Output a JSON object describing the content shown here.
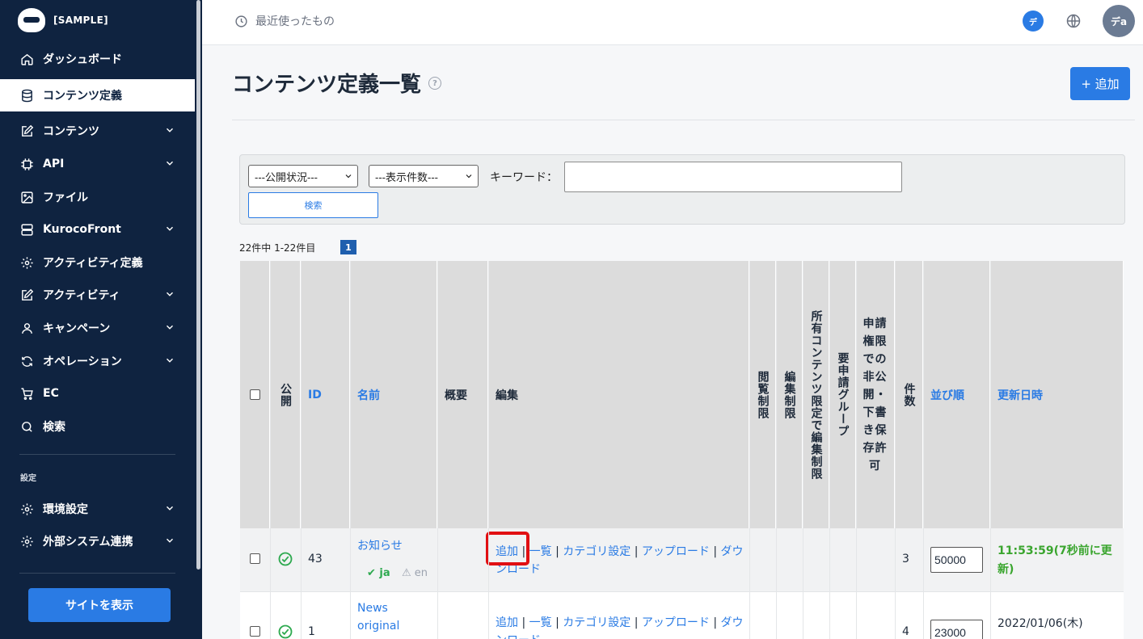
{
  "sidebar": {
    "brand": "[SAMPLE]",
    "items": [
      {
        "label": "ダッシュボード",
        "icon": "home-icon",
        "active": false,
        "chevron": false
      },
      {
        "label": "コンテンツ定義",
        "icon": "database-icon",
        "active": true,
        "chevron": false
      },
      {
        "label": "コンテンツ",
        "icon": "edit-icon",
        "active": false,
        "chevron": true
      },
      {
        "label": "API",
        "icon": "chip-icon",
        "active": false,
        "chevron": true
      },
      {
        "label": "ファイル",
        "icon": "image-icon",
        "active": false,
        "chevron": false
      },
      {
        "label": "KurocoFront",
        "icon": "server-icon",
        "active": false,
        "chevron": true
      },
      {
        "label": "アクティビティ定義",
        "icon": "gear-icon",
        "active": false,
        "chevron": false
      },
      {
        "label": "アクティビティ",
        "icon": "edit-icon",
        "active": false,
        "chevron": true
      },
      {
        "label": "キャンペーン",
        "icon": "user-icon",
        "active": false,
        "chevron": true
      },
      {
        "label": "オペレーション",
        "icon": "refresh-icon",
        "active": false,
        "chevron": true
      },
      {
        "label": "EC",
        "icon": "cart-icon",
        "active": false,
        "chevron": false
      },
      {
        "label": "検索",
        "icon": "search-icon",
        "active": false,
        "chevron": false
      }
    ],
    "section_label": "設定",
    "settings_items": [
      {
        "label": "環境設定",
        "icon": "gear-icon",
        "chevron": true
      },
      {
        "label": "外部システム連携",
        "icon": "gear-icon",
        "chevron": true
      }
    ],
    "view_site_label": "サイトを表示"
  },
  "header": {
    "recent_label": "最近使ったもの",
    "lang_badge": "デ",
    "avatar_text": "デa"
  },
  "main": {
    "title": "コンテンツ定義一覧",
    "help": "?",
    "add_label": "+ 追加",
    "filter": {
      "status_select": "---公開状況---",
      "count_select": "---表示件数---",
      "keyword_label": "キーワード：",
      "keyword_value": "",
      "search_label": "検索"
    },
    "pager_text": "22件中 1-22件目",
    "pager_current": "1",
    "table": {
      "headers": {
        "public": "公開",
        "id": "ID",
        "name": "名前",
        "summary": "概要",
        "edit": "編集",
        "view_limit": "閲覧制限",
        "edit_limit": "編集制限",
        "owner_limit": "所有コンテンツ限定で編集制限",
        "approval_group": "要申請グループ",
        "approval_save": "申請権限での非公開・下書き保存許可",
        "count": "件数",
        "order": "並び順",
        "updated": "更新日時"
      },
      "rows": [
        {
          "id": "43",
          "name": "お知らせ",
          "langs": [
            {
              "code": "ja",
              "status": "ok"
            },
            {
              "code": "en",
              "status": "warn"
            }
          ],
          "actions": [
            "追加",
            "一覧",
            "カテゴリ設定",
            "アップロード",
            "ダウンロード"
          ],
          "count": "3",
          "order": "50000",
          "updated": "11:53:59(7秒前に更新)",
          "updated_color": "#3aa52e"
        },
        {
          "id": "1",
          "name": "News original",
          "actions": [
            "追加",
            "一覧",
            "カテゴリ設定",
            "アップロード",
            "ダウンロード"
          ],
          "count": "4",
          "order": "23000",
          "updated": "2022/01/06(木)"
        }
      ]
    }
  },
  "colors": {
    "sidebar_bg": "#0f2340",
    "accent": "#2a7be4",
    "highlight": "#e10f12"
  }
}
